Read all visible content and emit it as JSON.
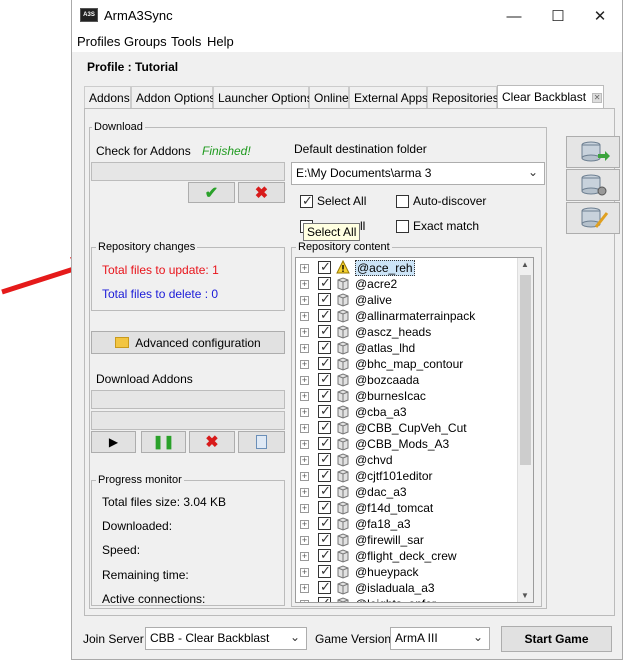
{
  "window": {
    "title": "ArmA3Sync"
  },
  "menu": [
    "Profiles",
    "Groups",
    "Tools",
    "Help"
  ],
  "profile_title": "Profile : Tutorial",
  "tabs": [
    "Addons",
    "Addon Options",
    "Launcher Options",
    "Online",
    "External Apps",
    "Repositories",
    "Clear Backblast"
  ],
  "download": {
    "group_label": "Download",
    "check_for_addons_label": "Check for Addons",
    "check_status": "Finished!",
    "default_destination_label": "Default destination folder",
    "destination_value": "E:\\My Documents\\arma 3",
    "select_all_label": "Select All",
    "auto_discover_label": "Auto-discover",
    "exact_match_label": "Exact match",
    "tooltip": "Select All",
    "hidden_checkbox_partial": "ll"
  },
  "repository_changes": {
    "group_label": "Repository changes",
    "total_to_update": "Total files to update: 1",
    "total_to_delete": "Total files to delete : 0"
  },
  "advanced_config_label": "Advanced configuration",
  "download_addons_label": "Download Addons",
  "progress_monitor": {
    "group_label": "Progress monitor",
    "total_size": "Total files size: 3.04 KB",
    "downloaded": "Downloaded:",
    "speed": "Speed:",
    "remaining": "Remaining time:",
    "active": "Active connections:"
  },
  "repository_content": {
    "group_label": "Repository content",
    "items": [
      "@ace_reh",
      "@acre2",
      "@alive",
      "@allinarmaterrainpack",
      "@ascz_heads",
      "@atlas_lhd",
      "@bhc_map_contour",
      "@bozcaada",
      "@burnesIcac",
      "@cba_a3",
      "@CBB_CupVeh_Cut",
      "@CBB_Mods_A3",
      "@chvd",
      "@cjtf101editor",
      "@dac_a3",
      "@f14d_tomcat",
      "@fa18_a3",
      "@firewill_sar",
      "@flight_deck_crew",
      "@hueypack",
      "@isladuala_a3",
      "@leights_opfor"
    ]
  },
  "bottom": {
    "join_server_label": "Join Server",
    "join_server_value": "CBB - Clear Backblast",
    "game_version_label": "Game Version",
    "game_version_value": "ArmA III",
    "start_game_label": "Start Game"
  },
  "colors": {
    "update_red": "#e8141b",
    "delete_blue": "#1b1bd8",
    "finished_green": "#1e9a1e",
    "arrow": "#e51a1a"
  }
}
